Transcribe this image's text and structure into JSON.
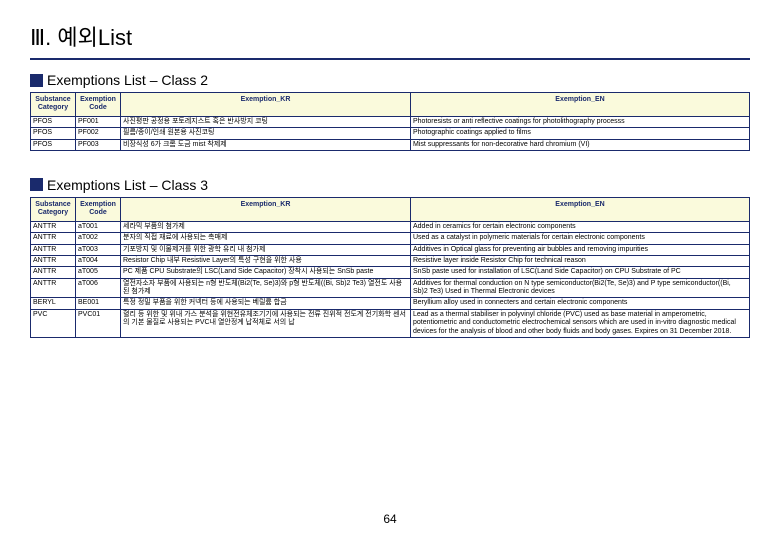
{
  "page": {
    "title": "Ⅲ. 예외List",
    "page_number": "64"
  },
  "section2": {
    "title": "Exemptions List – Class 2",
    "headers": {
      "category": "Substance Category",
      "code": "Exemption Code",
      "kr": "Exemption_KR",
      "en": "Exemption_EN"
    },
    "rows": [
      {
        "category": "PFOS",
        "code": "PF001",
        "kr": "사진평판 공정용 포토레지스트 혹은 반사방지 코팅",
        "en": "Photoresists or anti reflective coatings for photolithography processs"
      },
      {
        "category": "PFOS",
        "code": "PF002",
        "kr": "필름/종이/인쇄 원본용 사진코팅",
        "en": "Photographic coatings applied to films"
      },
      {
        "category": "PFOS",
        "code": "PF003",
        "kr": "비장식성 6가 크롬 도금 mist 착제제",
        "en": "Mist suppressants for non-decorative hard chromium (VI)"
      }
    ]
  },
  "section3": {
    "title": "Exemptions List – Class 3",
    "headers": {
      "category": "Substance Category",
      "code": "Exemption Code",
      "kr": "Exemption_KR",
      "en": "Exemption_EN"
    },
    "rows": [
      {
        "category": "ANTTR",
        "code": "aT001",
        "kr": "세라믹 부품의 첨가제",
        "en": "Added in ceramics for certain electronic components"
      },
      {
        "category": "ANTTR",
        "code": "aT002",
        "kr": "분자의 직접 재료에 사용되는 촉매제",
        "en": "Used as a catalyst in polymeric materials for certain electronic components"
      },
      {
        "category": "ANTTR",
        "code": "aT003",
        "kr": "기포방지 및 이물제거를 위한 광학 유리 내 첨가제",
        "en": "Additives in Optical glass for preventing air bubbles and removing impurities"
      },
      {
        "category": "ANTTR",
        "code": "aT004",
        "kr": "Resistor Chip 내부 Resistive Layer의 특성 구현을 위한 사용",
        "en": "Resistive layer inside Resistor Chip for technical reason"
      },
      {
        "category": "ANTTR",
        "code": "aT005",
        "kr": "PC 제품 CPU Substrate의 LSC(Land Side Capacitor) 장착시 사용되는 SnSb paste",
        "en": "SnSb paste used for installation of LSC(Land Side Capacitor) on CPU Substrate of PC"
      },
      {
        "category": "ANTTR",
        "code": "aT006",
        "kr": "열전자소자 부품에 사용되는 n형 반도체(Bi2(Te, Se)3)와 p형 반도체((Bi, Sb)2 Te3) 열전도 사용된 첨가제",
        "en": "Additives for thermal conduction on N type semiconductor(Bi2(Te, Se)3) and P type semiconductor((Bi, Sb)2 Te3) Used in Thermal Electronic devices"
      },
      {
        "category": "BERYL",
        "code": "BE001",
        "kr": "특정 정밀 부품을 위한 커넥터 등에 사용되는 베릴륨 합금",
        "en": "Beryllium alloy used in connecters and certain electronic components"
      },
      {
        "category": "PVC",
        "code": "PVC01",
        "kr": "혈리 등 위한 및 위내 가스 분석을 위현전유체조기기에 사용되는 전류 진위적 전도계 전기화학 센서의 기본 물질로 사용되는 PVC내 열안정계 납적체로 서의 납",
        "en": "Lead as a thermal stabiliser in polyvinyl chloride (PVC) used as base material in amperometric, potentiometric and conductometric electrochemical sensors which are used in in-vitro diagnostic medical devices for the analysis of blood and other body fluids and body gases. Expires on 31 December 2018."
      }
    ]
  }
}
